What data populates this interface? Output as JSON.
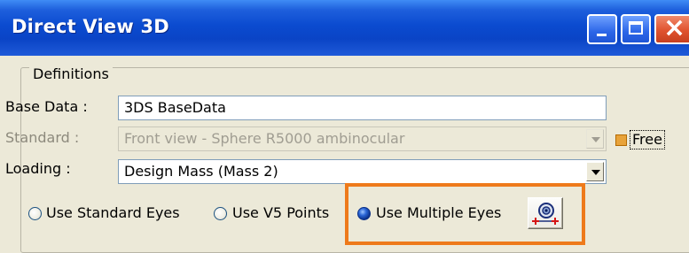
{
  "window": {
    "title": "Direct View 3D"
  },
  "definitions": {
    "group_label": "Definitions",
    "base_data": {
      "label": "Base Data :",
      "value": "3DS BaseData"
    },
    "standard": {
      "label": "Standard :",
      "value": "Front view - Sphere R5000 ambinocular",
      "enabled": false
    },
    "free_option": {
      "label": "Free",
      "checked": true
    },
    "loading": {
      "label": "Loading :",
      "value": "Design Mass (Mass 2)"
    }
  },
  "eye_mode": {
    "options": [
      {
        "label": "Use Standard Eyes",
        "selected": false
      },
      {
        "label": "Use V5 Points",
        "selected": false
      },
      {
        "label": "Use Multiple Eyes",
        "selected": true
      }
    ],
    "action_icon": "eye-positions-icon"
  },
  "colors": {
    "titlebar": "#0a44c6",
    "highlight": "#ee7a1b",
    "free_check": "#e8a33a"
  }
}
